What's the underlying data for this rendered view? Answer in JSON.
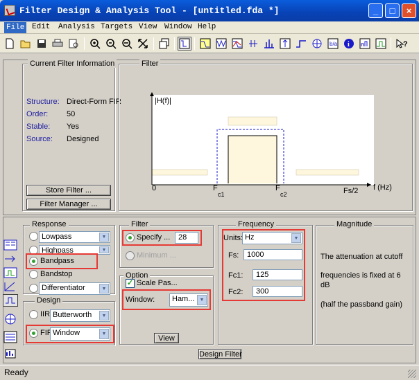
{
  "window": {
    "title": "Filter Design & Analysis Tool -  [untitled.fda *]",
    "minimize": "_",
    "maximize": "□",
    "close": "×"
  },
  "menu": [
    "File",
    "Edit",
    "Analysis",
    "Targets",
    "View",
    "Window",
    "Help"
  ],
  "toolbar_icons": [
    "new-icon",
    "open-icon",
    "save-icon",
    "print-icon",
    "print-preview-icon",
    "zoom-in-icon",
    "zoom-out-icon",
    "zoom-x-icon",
    "zoom-full-icon",
    "new-window-icon",
    "full-view-icon",
    "magnitude-icon",
    "phase-icon",
    "mag-phase-icon",
    "group-delay-icon",
    "impulse-icon",
    "step-icon",
    "pole-zero-icon",
    "coefficients-icon",
    "info-icon",
    "cost-icon",
    "rpz-icon",
    "whats-this-icon"
  ],
  "current_filter": {
    "legend": "Current Filter Information",
    "rows": [
      {
        "label": "Structure:",
        "value": "Direct-Form FIR"
      },
      {
        "label": "Order:",
        "value": "50"
      },
      {
        "label": "Stable:",
        "value": "Yes"
      },
      {
        "label": "Source:",
        "value": "Designed"
      }
    ],
    "store_button": "Store Filter ...",
    "manager_button": "Filter Manager ..."
  },
  "filter_diagram": {
    "legend": "Filter",
    "y_label": "|H(f)|",
    "x_label": "f (Hz)",
    "tick_0": "0",
    "tick_fc1": "F",
    "tick_fc1_sub": "c1",
    "tick_fc2": "F",
    "tick_fc2_sub": "c2",
    "tick_fs2": "Fs/2"
  },
  "response": {
    "legend": "Response",
    "options": [
      {
        "label": "Lowpass",
        "selected": false,
        "is_select": true
      },
      {
        "label": "Highpass",
        "selected": false,
        "is_select": true
      },
      {
        "label": "Bandpass",
        "selected": true,
        "is_select": false
      },
      {
        "label": "Bandstop",
        "selected": false,
        "is_select": false
      },
      {
        "label": "Differentiator",
        "selected": false,
        "is_select": true
      }
    ]
  },
  "design": {
    "legend": "Design",
    "iir_label": "IIR",
    "iir_value": "Butterworth",
    "fir_label": "FIR",
    "fir_value": "Window"
  },
  "order": {
    "legend": "Filter",
    "specify_label": "Specify ...",
    "specify_value": "28",
    "minimum_label": "Minimum ..."
  },
  "options": {
    "legend": "Option",
    "scale_label": "Scale Pas...",
    "window_label": "Window:",
    "window_value": "Ham...",
    "view_button": "View"
  },
  "frequency": {
    "legend": "Frequency",
    "units_label": "Units:",
    "units_value": "Hz",
    "fs_label": "Fs:",
    "fs_value": "1000",
    "fc1_label": "Fc1:",
    "fc1_value": "125",
    "fc2_label": "Fc2:",
    "fc2_value": "300"
  },
  "magnitude": {
    "legend": "Magnitude",
    "text1": "The attenuation at cutoff",
    "text2": "frequencies is fixed at 6",
    "text3": "dB",
    "text4": "(half the passband gain)"
  },
  "design_button": "Design Filter",
  "status": "Ready",
  "colors": {
    "highlight": "#e53935",
    "plot_band": "#fff7dd",
    "dashed": "#1a1ac8"
  }
}
